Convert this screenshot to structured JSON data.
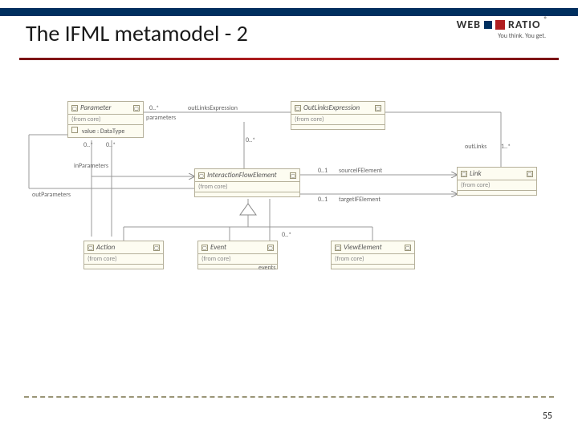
{
  "slide": {
    "title": "The IFML metamodel - 2",
    "page_number": "55"
  },
  "logo": {
    "brand_web": "WEB",
    "brand_ratio": "RATIO",
    "reg": "®",
    "tagline": "You think. You get."
  },
  "colors": {
    "header_bar": "#002f5f",
    "accent_rule": "#b11d1f",
    "box_fill": "#fdfcf1",
    "box_border": "#b5b09a"
  },
  "diagram": {
    "classes": {
      "parameter": {
        "name": "Parameter",
        "from": "(from core)",
        "attr": "value : DataType"
      },
      "outlinks_expression": {
        "name": "OutLinksExpression",
        "from": "(from core)"
      },
      "interaction_flow_element": {
        "name": "InteractionFlowElement",
        "from": "(from core)"
      },
      "link": {
        "name": "Link",
        "from": "(from core)"
      },
      "action": {
        "name": "Action",
        "from": "(from core)"
      },
      "event": {
        "name": "Event",
        "from": "(from core)"
      },
      "view_element": {
        "name": "ViewElement",
        "from": "(from core)"
      }
    },
    "associations": {
      "ole_expr_role": "outLinksExpression",
      "ole_expr_mult_left": "0..*",
      "ole_expr_mult_down": "0..*",
      "parameters_role": "parameters",
      "param_ole_mult": "0..*",
      "param_ife_mult": "0..*",
      "in_params": "inParameters",
      "out_params": "outParameters",
      "source_role": "sourceIFElement",
      "source_mult": "0..1",
      "target_role": "targetIFElement",
      "target_mult": "0..1",
      "outlinks_role": "outLinks",
      "outlinks_mult": "1..*",
      "events_role": "events",
      "events_mult": "0..*"
    },
    "icon_glyph": "▢"
  }
}
